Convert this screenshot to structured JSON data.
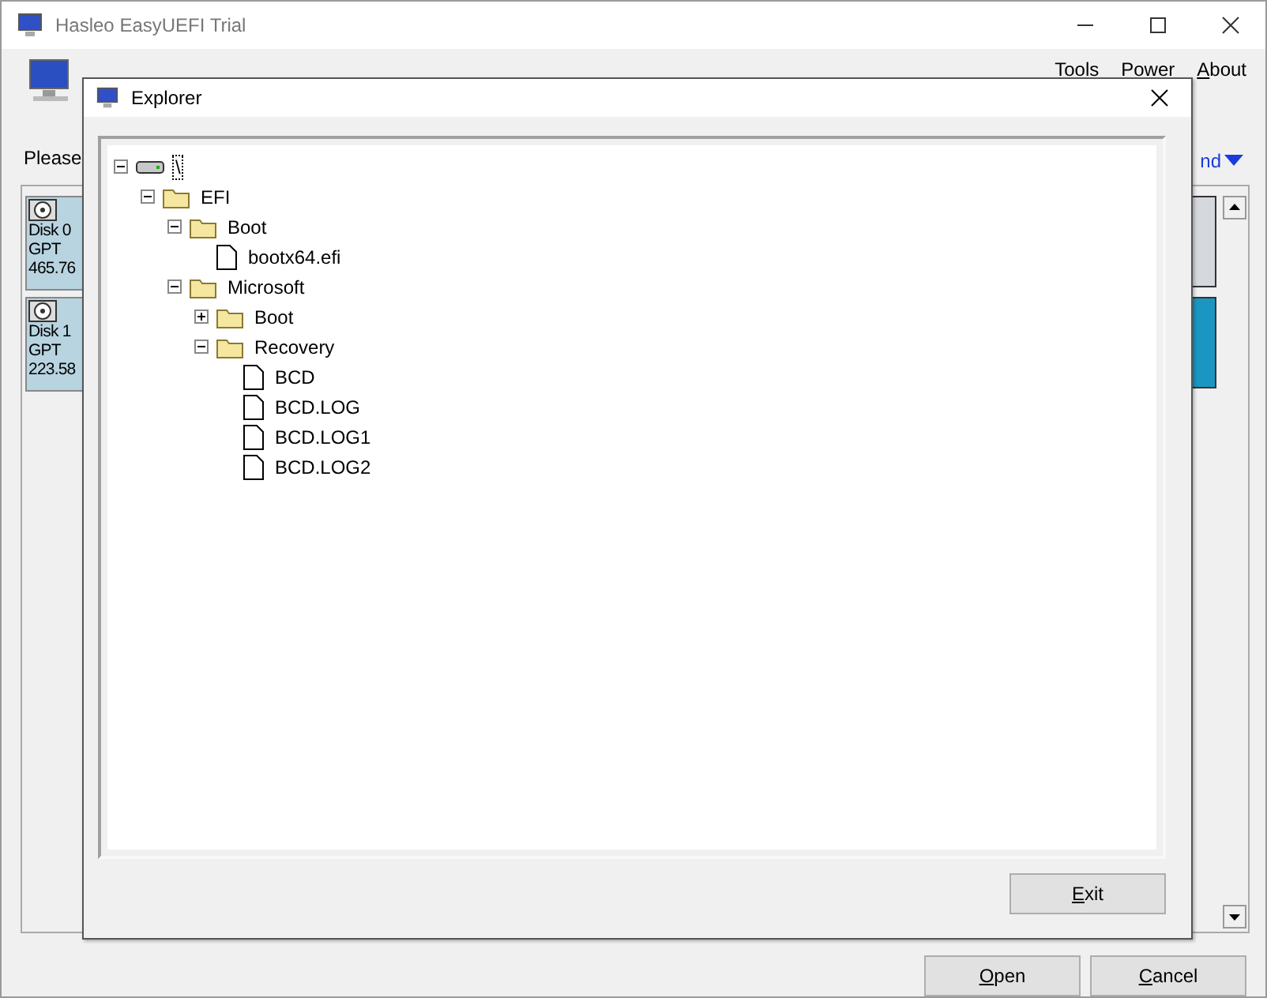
{
  "window": {
    "title": "Hasleo EasyUEFI Trial"
  },
  "menu": [
    {
      "label": "Tools"
    },
    {
      "label": "Power"
    },
    {
      "key_letter": "A",
      "rest": "bout"
    }
  ],
  "prompt": "Please",
  "more_link": "nd",
  "disks": [
    {
      "name": "Disk 0",
      "style": "GPT",
      "size": "465.76"
    },
    {
      "name": "Disk 1",
      "style": "GPT",
      "size": "223.58"
    }
  ],
  "main_buttons": [
    {
      "key_letter": "O",
      "rest": "pen"
    },
    {
      "key_letter": "C",
      "rest": "ancel"
    }
  ],
  "dialog": {
    "title": "Explorer",
    "tree": [
      {
        "kind": "drive",
        "label": "\\",
        "selected": true,
        "expanded": true,
        "children": [
          {
            "kind": "folder",
            "label": "EFI",
            "selected": false,
            "expanded": true,
            "children": [
              {
                "kind": "folder",
                "label": "Boot",
                "selected": false,
                "expanded": true,
                "children": [
                  {
                    "kind": "file",
                    "label": "bootx64.efi",
                    "selected": false
                  }
                ]
              },
              {
                "kind": "folder",
                "label": "Microsoft",
                "selected": false,
                "expanded": true,
                "children": [
                  {
                    "kind": "folder",
                    "label": "Boot",
                    "selected": false,
                    "expanded": false
                  },
                  {
                    "kind": "folder",
                    "label": "Recovery",
                    "selected": false,
                    "expanded": true,
                    "children": [
                      {
                        "kind": "file",
                        "label": "BCD",
                        "selected": false
                      },
                      {
                        "kind": "file",
                        "label": "BCD.LOG",
                        "selected": false
                      },
                      {
                        "kind": "file",
                        "label": "BCD.LOG1",
                        "selected": false
                      },
                      {
                        "kind": "file",
                        "label": "BCD.LOG2",
                        "selected": false
                      }
                    ]
                  }
                ]
              }
            ]
          }
        ]
      }
    ],
    "exit_button": {
      "key_letter": "E",
      "rest": "xit"
    }
  }
}
